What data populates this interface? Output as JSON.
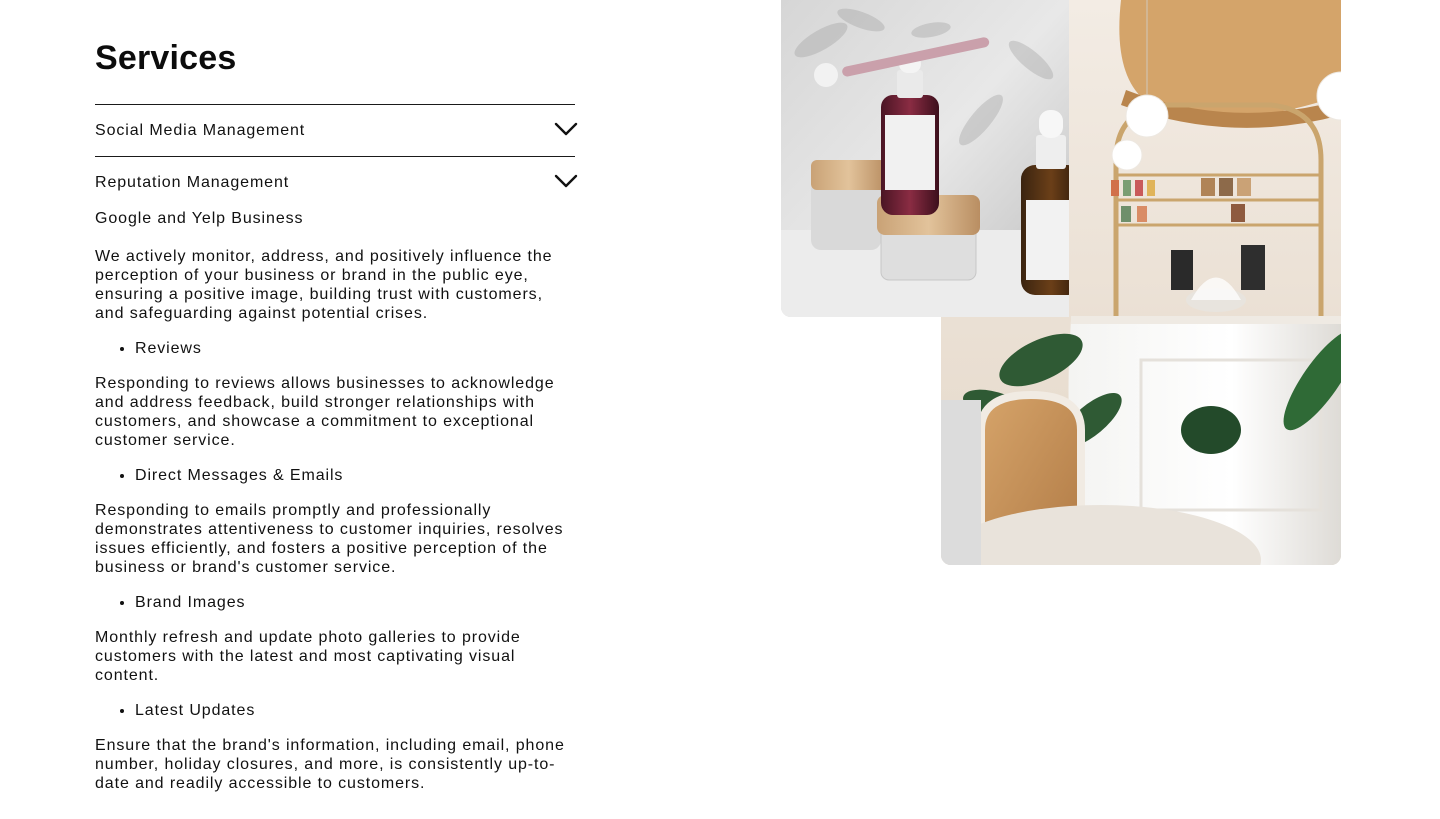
{
  "page": {
    "title": "Services"
  },
  "accordion": {
    "items": [
      {
        "title": "Social Media Management",
        "expanded": false,
        "icon": "chevron-down-icon"
      },
      {
        "title": "Reputation Management",
        "expanded": true,
        "icon": "chevron-down-icon",
        "subtitle": "Google and Yelp Business",
        "intro": "We actively monitor, address, and positively influence the perception of your business or brand in the public eye, ensuring a positive image, building trust with customers, and safeguarding against potential crises.",
        "sections": [
          {
            "bullet": "Reviews",
            "text": "Responding to reviews allows businesses to acknowledge and address feedback, build stronger relationships with customers, and showcase a commitment to exceptional customer service."
          },
          {
            "bullet": "Direct Messages & Emails",
            "text": "Responding to emails promptly and professionally demonstrates attentiveness to customer inquiries, resolves issues efficiently, and fosters a positive perception of the business or brand's customer service."
          },
          {
            "bullet": "Brand Images",
            "text": "Monthly refresh and update photo galleries to provide customers with the latest and most captivating visual content."
          },
          {
            "bullet": "Latest Updates",
            "text": "Ensure that the brand's information, including email, phone number, holiday closures, and more, is consistently up-to-date and readily accessible to customers."
          }
        ]
      }
    ]
  },
  "images": {
    "bottles": "skincare-bottles-photo",
    "cafe": "cafe-interior-photo"
  },
  "colors": {
    "text": "#111111",
    "divider": "#1a1a1a",
    "background": "#ffffff"
  }
}
